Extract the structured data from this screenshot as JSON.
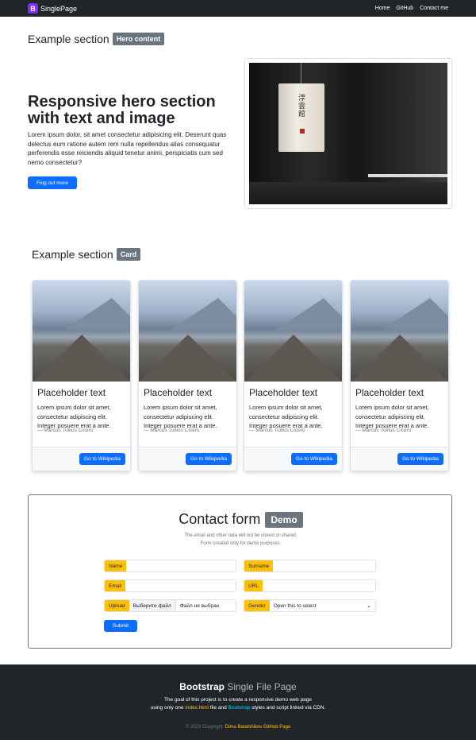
{
  "nav": {
    "brand_logo": "B",
    "brand": "SinglePage",
    "links": [
      "Home",
      "GitHub",
      "Contact me"
    ]
  },
  "hero_section": {
    "title": "Example section",
    "badge": "Hero content",
    "heading": "Responsive hero section with text and image",
    "text": "Lorem ipsum dolor, sit amet consectetur adipisicing elit. Deserunt quas delectus eum ratione autem rem nulla repellendus alias consequatur perferendis esse reiciendis aliquid tenetur animi, perspiciatis cum sed nemo consectetur?",
    "button": "Fing out more",
    "image_glyphs": "淳雲館"
  },
  "card_section": {
    "title": "Example section",
    "badge": "Card",
    "cards": [
      {
        "title": "Placeholder text",
        "text": "Lorem ipsum dolor sit amet, consectetur adipiscing elit. Integer posuere erat a ante.",
        "cite": "— Marcus Tullius Cicero",
        "button": "Go to Wikipedia"
      },
      {
        "title": "Placeholder text",
        "text": "Lorem ipsum dolor sit amet, consectetur adipiscing elit. Integer posuere erat a ante.",
        "cite": "— Marcus Tullius Cicero",
        "button": "Go to Wikipedia"
      },
      {
        "title": "Placeholder text",
        "text": "Lorem ipsum dolor sit amet, consectetur adipiscing elit. Integer posuere erat a ante.",
        "cite": "— Marcus Tullius Cicero",
        "button": "Go to Wikipedia"
      },
      {
        "title": "Placeholder text",
        "text": "Lorem ipsum dolor sit amet, consectetur adipiscing elit. Integer posuere erat a ante.",
        "cite": "— Marcus Tullius Cicero",
        "button": "Go to Wikipedia"
      }
    ]
  },
  "contact": {
    "title": "Contact form",
    "badge": "Demo",
    "note_line1": "The email and other data will not be stored or shared.",
    "note_line2": "Form created only for demo purposes.",
    "fields": {
      "name": {
        "label": "Name",
        "value": ""
      },
      "surname": {
        "label": "Surname",
        "value": ""
      },
      "email": {
        "label": "Email",
        "value": ""
      },
      "url": {
        "label": "URL",
        "value": ""
      },
      "upload": {
        "label": "Upload",
        "button": "Выберите файл",
        "status": "Файл не выбран"
      },
      "gender": {
        "label": "Gender",
        "selected": "Open this to select"
      }
    },
    "submit": "Submit"
  },
  "footer": {
    "title_bold": "Bootstrap",
    "title_light": "Single File Page",
    "desc_line1": "The goal of this project is to create a responsive demo web page",
    "desc_pre": "using only one ",
    "desc_file": "index.html",
    "desc_mid": " file and ",
    "desc_lib": "Bootstrap",
    "desc_post": " styles and script linked via CDN.",
    "copy_pre": "© 2023 Copyright: ",
    "copy_link": "Dima Batalshikov GitHub Page"
  },
  "colors": {
    "primary": "#0d6efd",
    "badge": "#6c757d",
    "warning": "#ffc107",
    "dark": "#212529",
    "brand": "#7b2ff7"
  }
}
